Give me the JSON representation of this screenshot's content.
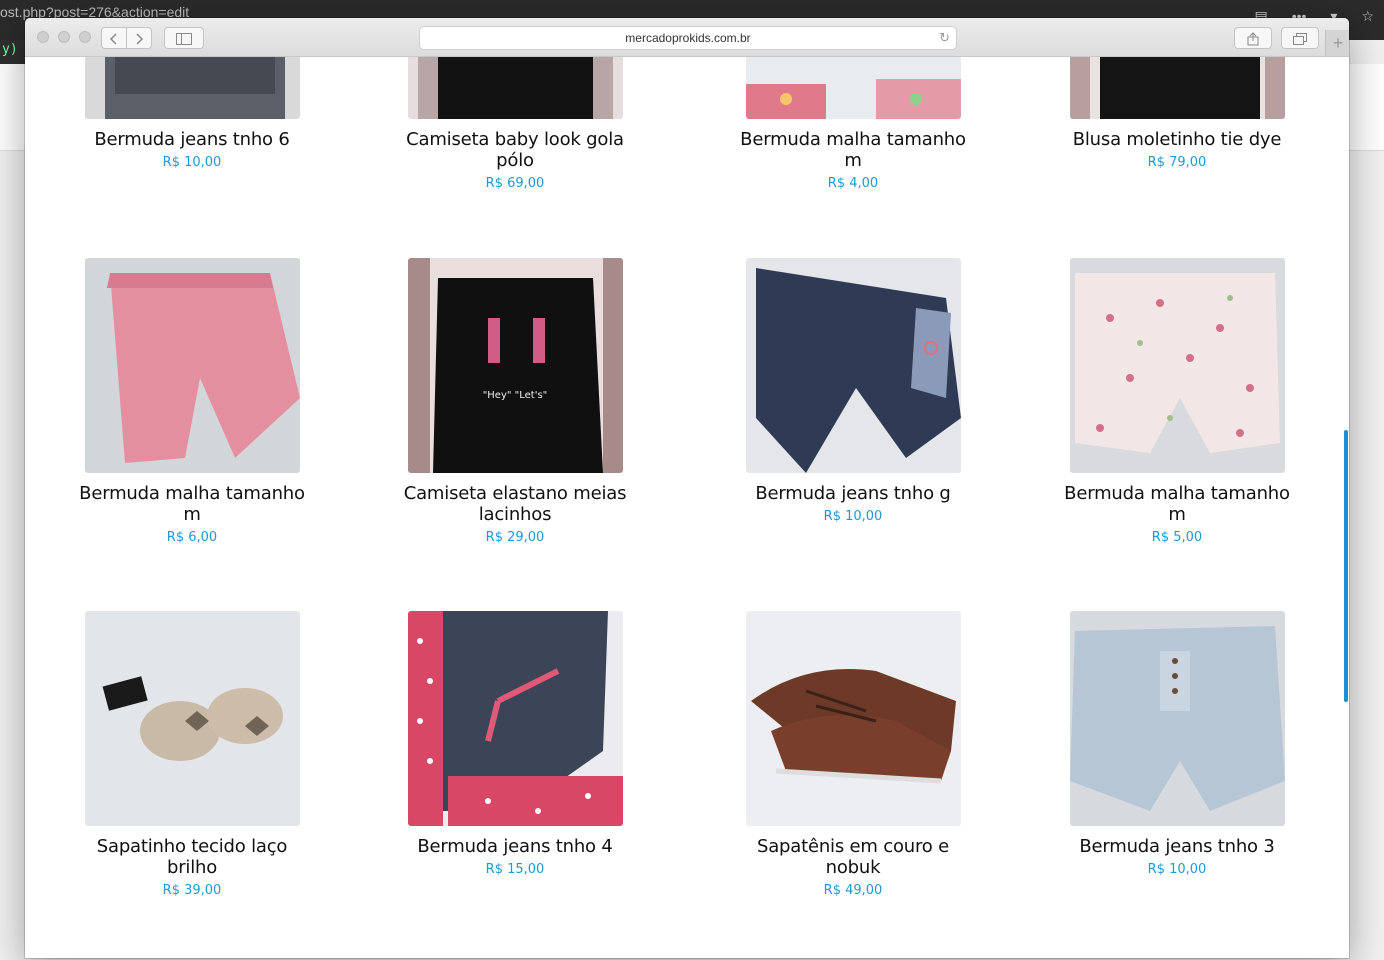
{
  "background_window": {
    "url_fragment": "ost.php?post=276&action=edit",
    "strip_text": "y)"
  },
  "browser": {
    "address": "mercadoprokids.com.br",
    "back_icon": "chevron-left-icon",
    "forward_icon": "chevron-right-icon",
    "sidebar_icon": "sidebar-icon",
    "reload_icon": "reload-icon",
    "share_icon": "share-icon",
    "tabs_icon": "tabs-icon",
    "new_tab_label": "+"
  },
  "products": [
    {
      "name": "Bermuda jeans tnho 6",
      "price": "R$ 10,00"
    },
    {
      "name": "Camiseta baby look gola pólo",
      "price": "R$ 69,00"
    },
    {
      "name": "Bermuda malha tamanho m",
      "price": "R$ 4,00"
    },
    {
      "name": "Blusa moletinho tie dye",
      "price": "R$ 79,00"
    },
    {
      "name": "Bermuda malha tamanho m",
      "price": "R$ 6,00"
    },
    {
      "name": "Camiseta elastano meias lacinhos",
      "price": "R$ 29,00"
    },
    {
      "name": "Bermuda jeans tnho g",
      "price": "R$ 10,00"
    },
    {
      "name": "Bermuda malha tamanho m",
      "price": "R$ 5,00"
    },
    {
      "name": "Sapatinho tecido laço brilho",
      "price": "R$ 39,00"
    },
    {
      "name": "Bermuda jeans tnho 4",
      "price": "R$ 15,00"
    },
    {
      "name": "Sapatênis em couro e nobuk",
      "price": "R$ 49,00"
    },
    {
      "name": "Bermuda jeans tnho 3",
      "price": "R$ 10,00"
    }
  ],
  "colors": {
    "price": "#1a9ad6",
    "scroll_indicator": "#1a8fd8"
  }
}
